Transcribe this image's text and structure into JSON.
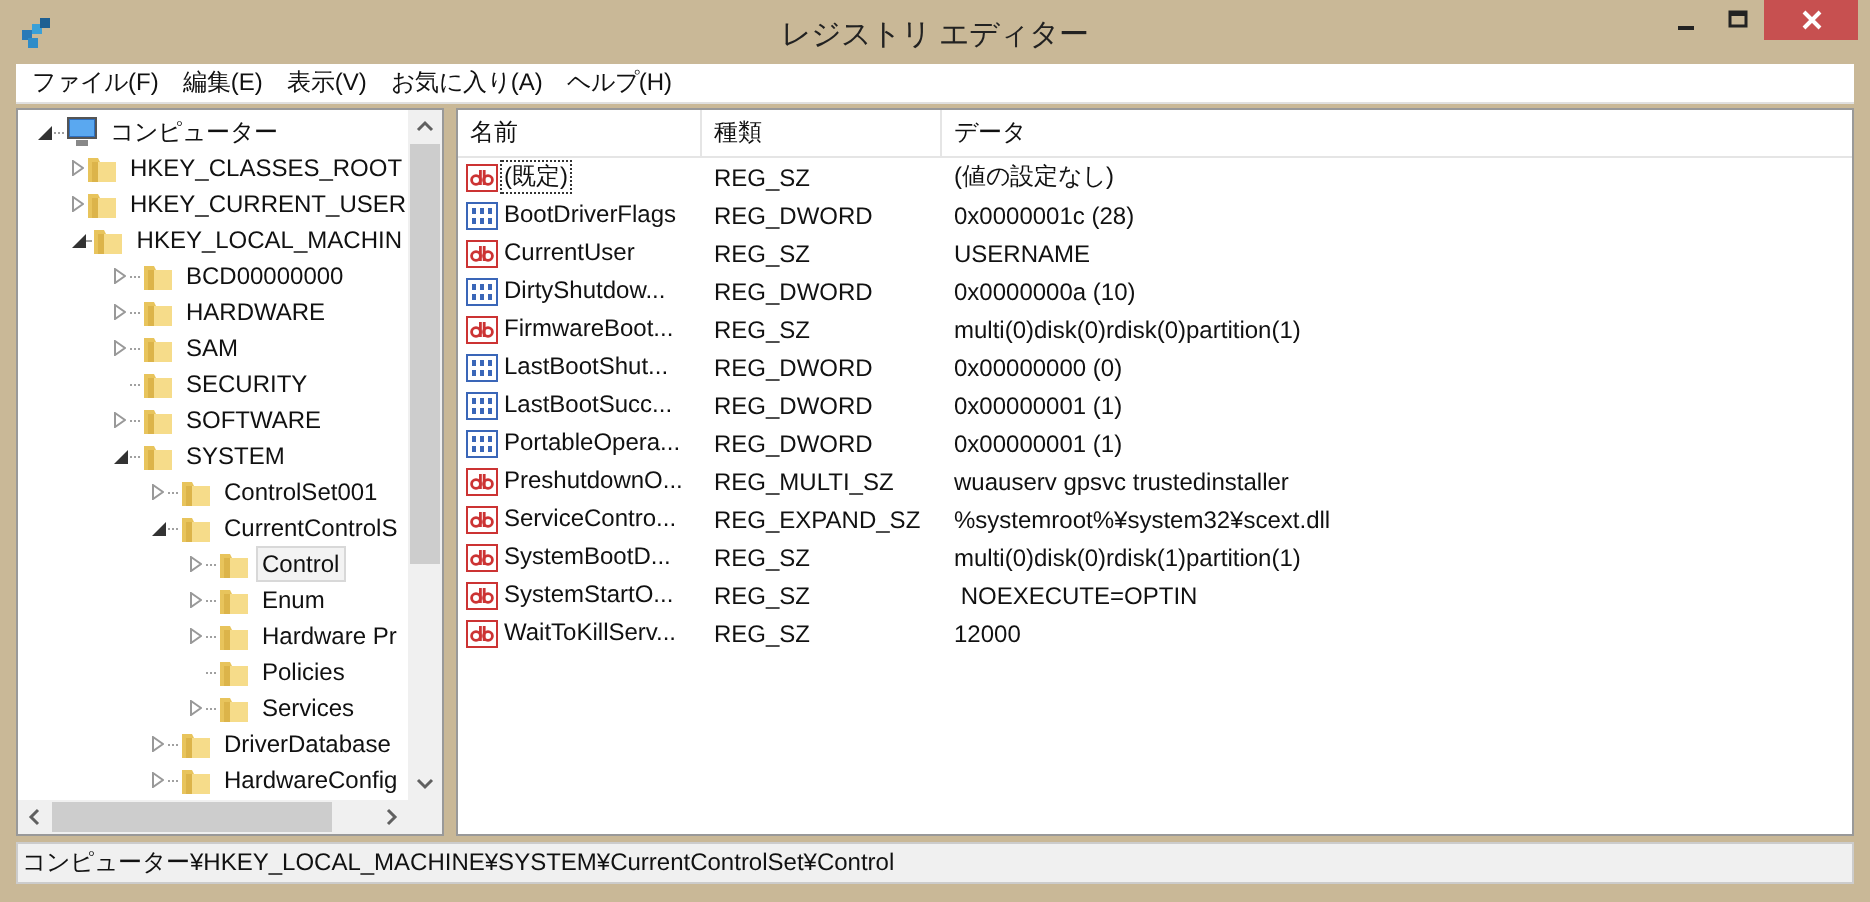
{
  "window": {
    "title": "レジストリ エディター"
  },
  "menu": [
    "ファイル(F)",
    "編集(E)",
    "表示(V)",
    "お気に入り(A)",
    "ヘルプ(H)"
  ],
  "tree": [
    {
      "label": "コンピューター",
      "kind": "expanded",
      "selected": false,
      "children": [
        {
          "label": "HKEY_CLASSES_ROOT",
          "kind": "collapsed",
          "selected": false
        },
        {
          "label": "HKEY_CURRENT_USER",
          "kind": "collapsed",
          "selected": false
        },
        {
          "label": "HKEY_LOCAL_MACHIN",
          "kind": "expanded",
          "selected": false,
          "children": [
            {
              "label": "BCD00000000",
              "kind": "collapsed",
              "selected": false
            },
            {
              "label": "HARDWARE",
              "kind": "collapsed",
              "selected": false
            },
            {
              "label": "SAM",
              "kind": "collapsed",
              "selected": false
            },
            {
              "label": "SECURITY",
              "kind": "leaf",
              "selected": false
            },
            {
              "label": "SOFTWARE",
              "kind": "collapsed",
              "selected": false
            },
            {
              "label": "SYSTEM",
              "kind": "expanded",
              "selected": false,
              "children": [
                {
                  "label": "ControlSet001",
                  "kind": "collapsed",
                  "selected": false
                },
                {
                  "label": "CurrentControlS",
                  "kind": "expanded",
                  "selected": false,
                  "children": [
                    {
                      "label": "Control",
                      "kind": "collapsed",
                      "selected": true
                    },
                    {
                      "label": "Enum",
                      "kind": "collapsed",
                      "selected": false
                    },
                    {
                      "label": "Hardware Pr",
                      "kind": "collapsed",
                      "selected": false
                    },
                    {
                      "label": "Policies",
                      "kind": "leaf",
                      "selected": false
                    },
                    {
                      "label": "Services",
                      "kind": "collapsed",
                      "selected": false
                    }
                  ]
                },
                {
                  "label": "DriverDatabase",
                  "kind": "collapsed",
                  "selected": false
                },
                {
                  "label": "HardwareConfig",
                  "kind": "collapsed",
                  "selected": false
                }
              ]
            }
          ]
        }
      ]
    }
  ],
  "values": {
    "columns": [
      "名前",
      "種類",
      "データ"
    ],
    "rows": [
      {
        "name": "(既定)",
        "kind": "string",
        "type": "REG_SZ",
        "data": "(値の設定なし)",
        "focused": true
      },
      {
        "name": "BootDriverFlags",
        "kind": "binary",
        "type": "REG_DWORD",
        "data": "0x0000001c (28)",
        "focused": false
      },
      {
        "name": "CurrentUser",
        "kind": "string",
        "type": "REG_SZ",
        "data": "USERNAME",
        "focused": false
      },
      {
        "name": "DirtyShutdow...",
        "kind": "binary",
        "type": "REG_DWORD",
        "data": "0x0000000a (10)",
        "focused": false
      },
      {
        "name": "FirmwareBoot...",
        "kind": "string",
        "type": "REG_SZ",
        "data": "multi(0)disk(0)rdisk(0)partition(1)",
        "focused": false
      },
      {
        "name": "LastBootShut...",
        "kind": "binary",
        "type": "REG_DWORD",
        "data": "0x00000000 (0)",
        "focused": false
      },
      {
        "name": "LastBootSucc...",
        "kind": "binary",
        "type": "REG_DWORD",
        "data": "0x00000001 (1)",
        "focused": false
      },
      {
        "name": "PortableOpera...",
        "kind": "binary",
        "type": "REG_DWORD",
        "data": "0x00000001 (1)",
        "focused": false
      },
      {
        "name": "PreshutdownO...",
        "kind": "string",
        "type": "REG_MULTI_SZ",
        "data": "wuauserv gpsvc trustedinstaller",
        "focused": false
      },
      {
        "name": "ServiceContro...",
        "kind": "string",
        "type": "REG_EXPAND_SZ",
        "data": "%systemroot%¥system32¥scext.dll",
        "focused": false
      },
      {
        "name": "SystemBootD...",
        "kind": "string",
        "type": "REG_SZ",
        "data": "multi(0)disk(0)rdisk(1)partition(1)",
        "focused": false
      },
      {
        "name": "SystemStartO...",
        "kind": "string",
        "type": "REG_SZ",
        "data": " NOEXECUTE=OPTIN",
        "focused": false
      },
      {
        "name": "WaitToKillServ...",
        "kind": "string",
        "type": "REG_SZ",
        "data": "12000",
        "focused": false
      }
    ]
  },
  "status_bar": "コンピューター¥HKEY_LOCAL_MACHINE¥SYSTEM¥CurrentControlSet¥Control"
}
